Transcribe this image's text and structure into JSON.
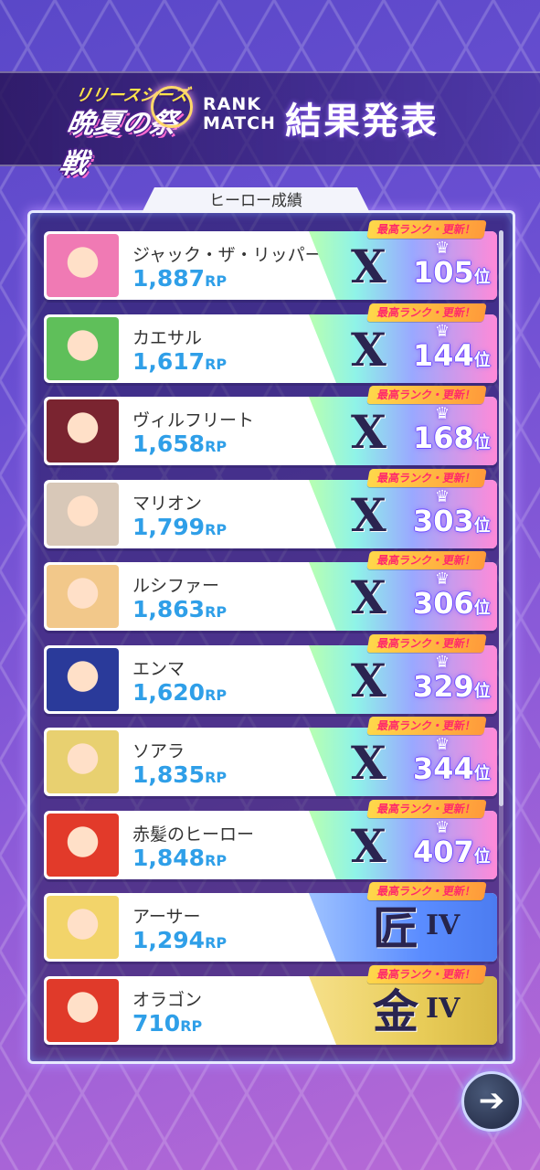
{
  "header": {
    "logo_line1": "リリースシーズン",
    "logo_line2": "晩夏の祭戦",
    "rank_match_line1": "RANK",
    "rank_match_line2": "MATCH",
    "title": "結果発表"
  },
  "panel": {
    "tab_label": "ヒーロー成績"
  },
  "badge_text": "最高ランク・更新！",
  "rp_unit": "RP",
  "position_suffix": "位",
  "heroes": [
    {
      "name": "ジャック・ザ・リッパー",
      "rp": "1,887",
      "rank_type": "master",
      "emblem": "X",
      "rank_no": "105"
    },
    {
      "name": "カエサル",
      "rp": "1,617",
      "rank_type": "master",
      "emblem": "X",
      "rank_no": "144"
    },
    {
      "name": "ヴィルフリート",
      "rp": "1,658",
      "rank_type": "master",
      "emblem": "X",
      "rank_no": "168"
    },
    {
      "name": "マリオン",
      "rp": "1,799",
      "rank_type": "master",
      "emblem": "X",
      "rank_no": "303"
    },
    {
      "name": "ルシファー",
      "rp": "1,863",
      "rank_type": "master",
      "emblem": "X",
      "rank_no": "306"
    },
    {
      "name": "エンマ",
      "rp": "1,620",
      "rank_type": "master",
      "emblem": "X",
      "rank_no": "329"
    },
    {
      "name": "ソアラ",
      "rp": "1,835",
      "rank_type": "master",
      "emblem": "X",
      "rank_no": "344"
    },
    {
      "name": "赤髪のヒーロー",
      "rp": "1,848",
      "rank_type": "master",
      "emblem": "X",
      "rank_no": "407"
    },
    {
      "name": "アーサー",
      "rp": "1,294",
      "rank_type": "artisan",
      "emblem": "匠",
      "tier": "IV"
    },
    {
      "name": "オラゴン",
      "rp": "710",
      "rank_type": "gold",
      "emblem": "金",
      "tier": "IV"
    }
  ],
  "next_button": {
    "icon": "arrow-right-icon"
  },
  "colors": {
    "rp": "#2f9fe8",
    "avatars": [
      "#f07ab4",
      "#5fbf5a",
      "#7a2430",
      "#d8c8b8",
      "#f2c88a",
      "#2a3a9a",
      "#e8d070",
      "#e23a2a",
      "#f2d46a",
      "#e03a2a"
    ]
  }
}
